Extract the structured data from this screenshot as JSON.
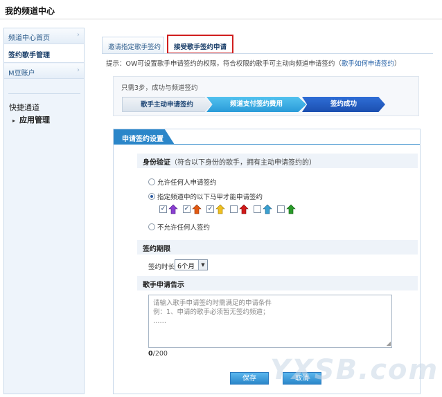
{
  "window": {
    "title": "我的频道中心"
  },
  "sidebar": {
    "items": [
      {
        "label": "频道中心首页",
        "active": false
      },
      {
        "label": "签约歌手管理",
        "active": true
      },
      {
        "label": "M豆账户",
        "active": false
      }
    ],
    "quick_title": "快捷通道",
    "quick_items": [
      {
        "label": "应用管理"
      }
    ],
    "chevron": "›"
  },
  "tabs": [
    {
      "label": "邀请指定歌手签约",
      "active": false
    },
    {
      "label": "接受歌手签约申请",
      "active": true
    }
  ],
  "hint": {
    "text": "提示：OW可设置歌手申请签约的权限，符合权限的歌手可主动向频道申请签约（",
    "link": "歌手如何申请签约",
    "close": "）"
  },
  "steps": {
    "caption": "只需3步，成功与频道签约",
    "items": [
      {
        "label": "歌手主动申请签约"
      },
      {
        "label": "频道支付签约费用"
      },
      {
        "label": "签约成功"
      }
    ]
  },
  "settings": {
    "panel_title": "申请签约设置",
    "identity": {
      "title": "身份验证",
      "subtitle": "（符合以下身份的歌手，拥有主动申请签约的）",
      "options": [
        {
          "label": "允许任何人申请签约",
          "selected": false
        },
        {
          "label": "指定频道中的以下马甲才能申请签约",
          "selected": true
        },
        {
          "label": "不允许任何人签约",
          "selected": false
        }
      ],
      "vips": [
        {
          "checked": true,
          "color": "#8a3fd1",
          "icon": "vest-purple-icon"
        },
        {
          "checked": true,
          "color": "#e25a12",
          "icon": "vest-orange-icon"
        },
        {
          "checked": true,
          "color": "#f0c020",
          "icon": "vest-yellow-icon"
        },
        {
          "checked": false,
          "color": "#d11a1a",
          "icon": "vest-red-icon"
        },
        {
          "checked": false,
          "color": "#3aa0d0",
          "icon": "vest-blue-icon"
        },
        {
          "checked": false,
          "color": "#2a9a2a",
          "icon": "vest-green-icon"
        }
      ],
      "check_mark": "✓"
    },
    "period": {
      "title": "签约期限",
      "label": "签约时长",
      "value": "6个月",
      "dropdown": "▼"
    },
    "notice": {
      "title": "歌手申请告示",
      "placeholder_line1": "请输入歌手申请签约时需满足的申请条件",
      "placeholder_line2": "例：1、申请的歌手必须暂无签约频道；",
      "placeholder_line3": "……",
      "count": "0",
      "max": "/200"
    },
    "buttons": {
      "save": "保存",
      "cancel": "取消"
    }
  },
  "watermark": "YXSB.com"
}
